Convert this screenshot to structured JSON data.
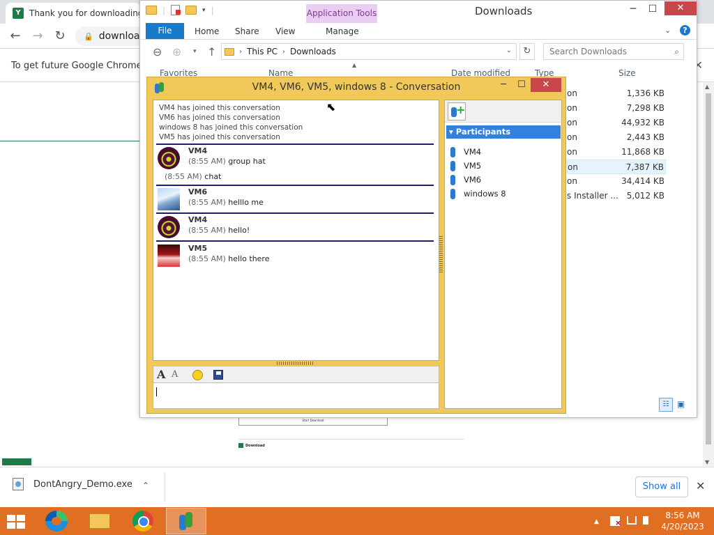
{
  "chrome": {
    "tab_title": "Thank you for downloading D",
    "tab_favicon_letter": "Y",
    "address": "download",
    "infobar_text": "To get future Google Chrome up",
    "page": {
      "brand": "Download",
      "download_box_label": "Start Download"
    },
    "download_shelf": {
      "file_name": "DontAngry_Demo.exe",
      "show_all": "Show all"
    }
  },
  "explorer": {
    "window_title": "Downloads",
    "app_tools": "Application Tools",
    "ribbon_tabs": [
      "File",
      "Home",
      "Share",
      "View",
      "Manage"
    ],
    "address": [
      "This PC",
      "Downloads"
    ],
    "search_placeholder": "Search Downloads",
    "columns": [
      "Name",
      "Date modified",
      "Type",
      "Size"
    ],
    "rows": [
      {
        "type": "on",
        "size": "1,336 KB"
      },
      {
        "type": "on",
        "size": "7,298 KB"
      },
      {
        "type": "on",
        "size": "44,932 KB"
      },
      {
        "type": "on",
        "size": "2,443 KB"
      },
      {
        "type": "on",
        "size": "11,868 KB"
      },
      {
        "type": "on",
        "size": "7,387 KB"
      },
      {
        "type": "on",
        "size": "34,414 KB"
      },
      {
        "type": "s Installer ...",
        "size": "5,012 KB"
      }
    ],
    "nav_pane_first": "Favorites"
  },
  "conversation": {
    "title": "VM4, VM6, VM5, windows 8 - Conversation",
    "system_messages": [
      "VM4 has joined this conversation",
      "VM6 has joined this conversation",
      "windows 8 has joined this conversation",
      "VM5 has joined this conversation"
    ],
    "messages": [
      {
        "sender": "VM4",
        "time": "(8:55 AM)",
        "text": "group hat",
        "cont_time": "(8:55 AM)",
        "cont_text": "chat"
      },
      {
        "sender": "VM6",
        "time": "(8:55 AM)",
        "text": "helllo me"
      },
      {
        "sender": "VM4",
        "time": "(8:55 AM)",
        "text": "hello!"
      },
      {
        "sender": "VM5",
        "time": "(8:55 AM)",
        "text": "hello there"
      }
    ],
    "participants_header": "Participants",
    "participants": [
      "VM4",
      "VM5",
      "VM6",
      "windows 8"
    ],
    "input_value": ""
  },
  "taskbar": {
    "time": "8:56 AM",
    "date": "4/20/2023"
  },
  "colors": {
    "taskbar": "#e06f24",
    "conversation_frame": "#f0c95a",
    "participants_header": "#3280e0",
    "explorer_file_tab": "#1979ca",
    "close_button": "#c7474b"
  }
}
